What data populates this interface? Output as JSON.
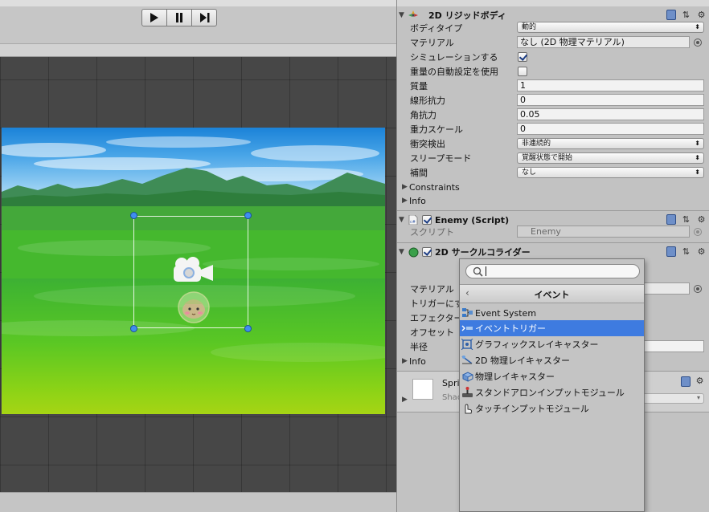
{
  "playback": {
    "play_icon": "play-icon",
    "pause_icon": "pause-icon",
    "step_icon": "step-icon"
  },
  "rigidbody": {
    "title": "2D リジッドボディ",
    "fields": {
      "body_type": {
        "label": "ボディタイプ",
        "value": "動的"
      },
      "material": {
        "label": "マテリアル",
        "value": "なし (2D 物理マテリアル)"
      },
      "simulated": {
        "label": "シミュレーションする",
        "checked": true
      },
      "auto_mass": {
        "label": "重量の自動設定を使用",
        "checked": false
      },
      "mass": {
        "label": "質量",
        "value": "1"
      },
      "linear_drag": {
        "label": "線形抗力",
        "value": "0"
      },
      "angular_drag": {
        "label": "角抗力",
        "value": "0.05"
      },
      "gravity_scale": {
        "label": "重力スケール",
        "value": "0"
      },
      "collision_detection": {
        "label": "衝突検出",
        "value": "非連続的"
      },
      "sleep_mode": {
        "label": "スリープモード",
        "value": "覚醒状態で開始"
      },
      "interpolate": {
        "label": "補間",
        "value": "なし"
      }
    },
    "constraints_label": "Constraints",
    "info_label": "Info"
  },
  "enemy_script": {
    "title": "Enemy (Script)",
    "script_label": "スクリプト",
    "script_value": "Enemy"
  },
  "circle_collider": {
    "title": "2D サークルコライダー",
    "labels": {
      "material": "マテリアル",
      "is_trigger": "トリガーにする",
      "used_by_effector": "エフェクターで使",
      "offset": "オフセット",
      "radius": "半径"
    },
    "info_label": "Info"
  },
  "sprite_section": {
    "title_partial": "Sprit",
    "shader_partial": "Shad"
  },
  "popup": {
    "search_value": "",
    "header": "イベント",
    "items": [
      {
        "label": "Event System",
        "icon": "event-system-icon",
        "selected": false
      },
      {
        "label": "イベントトリガー",
        "icon": "event-trigger-icon",
        "selected": true
      },
      {
        "label": "グラフィックスレイキャスター",
        "icon": "graphic-raycaster-icon",
        "selected": false
      },
      {
        "label": "2D 物理レイキャスター",
        "icon": "physics2d-raycaster-icon",
        "selected": false
      },
      {
        "label": "物理レイキャスター",
        "icon": "physics-raycaster-icon",
        "selected": false
      },
      {
        "label": "スタンドアロンインプットモジュール",
        "icon": "standalone-input-icon",
        "selected": false
      },
      {
        "label": "タッチインプットモジュール",
        "icon": "touch-input-icon",
        "selected": false
      }
    ]
  },
  "colors": {
    "selection": "#3e7be0",
    "handle": "#3f8ef0",
    "grid_bg": "#474747"
  }
}
